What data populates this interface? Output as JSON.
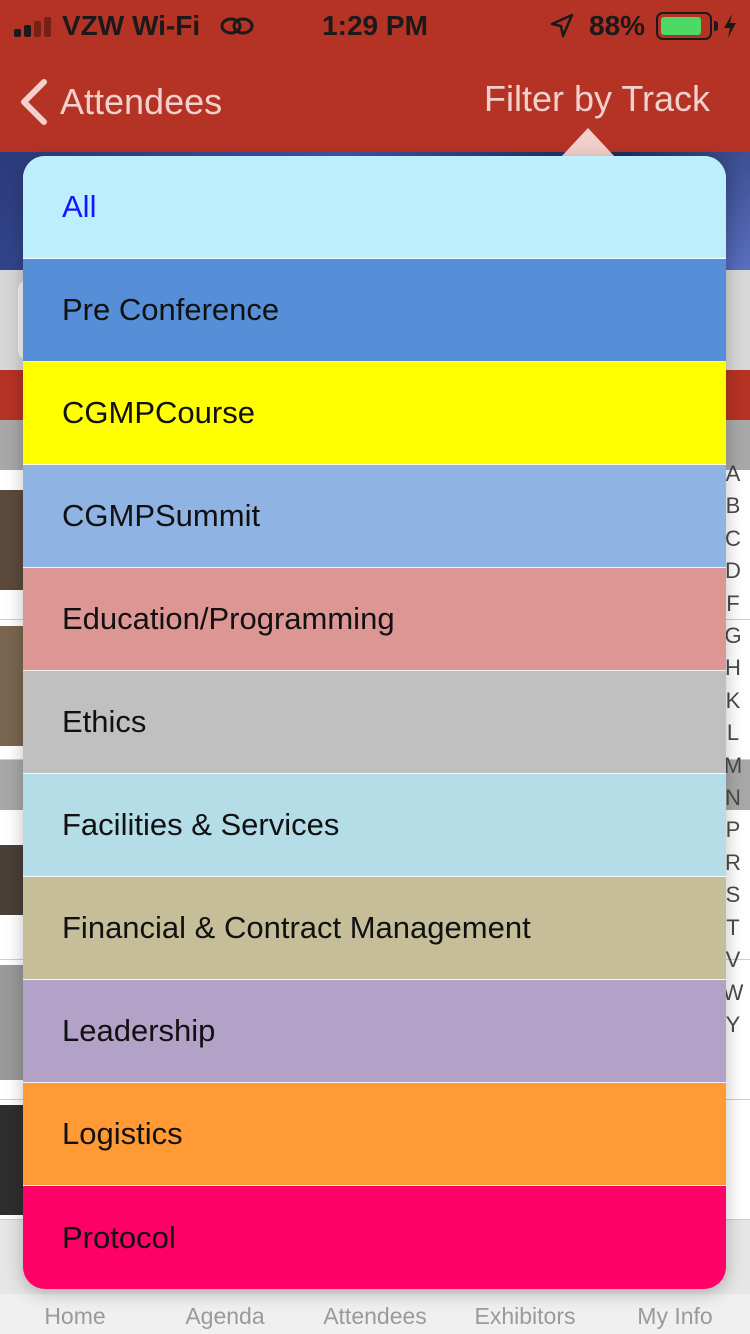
{
  "status": {
    "carrier": "VZW Wi-Fi",
    "time": "1:29 PM",
    "battery": "88%",
    "battery_level": 0.88,
    "icons": [
      "cellular-signal-icon",
      "wifi-calling-icon",
      "location-arrow-icon",
      "battery-icon",
      "charging-bolt-icon"
    ]
  },
  "nav": {
    "back_label": "Attendees",
    "filter_label": "Filter by Track"
  },
  "tracks": [
    {
      "label": "All",
      "bg": "#bdeefb",
      "fg": "#1414ff"
    },
    {
      "label": "Pre Conference",
      "bg": "#568fd8",
      "fg": "#111111"
    },
    {
      "label": "CGMPCourse",
      "bg": "#ffff00",
      "fg": "#111111"
    },
    {
      "label": "CGMPSummit",
      "bg": "#8fb3e3",
      "fg": "#111111"
    },
    {
      "label": "Education/Programming",
      "bg": "#dc9694",
      "fg": "#111111"
    },
    {
      "label": "Ethics",
      "bg": "#c0c0c0",
      "fg": "#111111"
    },
    {
      "label": "Facilities & Services",
      "bg": "#b5dde8",
      "fg": "#111111"
    },
    {
      "label": "Financial & Contract Management",
      "bg": "#c5be99",
      "fg": "#111111"
    },
    {
      "label": "Leadership",
      "bg": "#b2a2c8",
      "fg": "#111111"
    },
    {
      "label": "Logistics",
      "bg": "#ff9a35",
      "fg": "#111111"
    },
    {
      "label": "Protocol",
      "bg": "#ff0066",
      "fg": "#111111"
    }
  ],
  "index_letters": [
    "A",
    "B",
    "C",
    "D",
    "F",
    "G",
    "H",
    "K",
    "L",
    "M",
    "N",
    "P",
    "R",
    "S",
    "T",
    "V",
    "W",
    "Y"
  ],
  "tabs": [
    "Home",
    "Agenda",
    "Attendees",
    "Exhibitors",
    "My Info"
  ],
  "colors": {
    "header": "#b53324",
    "header_text": "#f3d0cb"
  }
}
